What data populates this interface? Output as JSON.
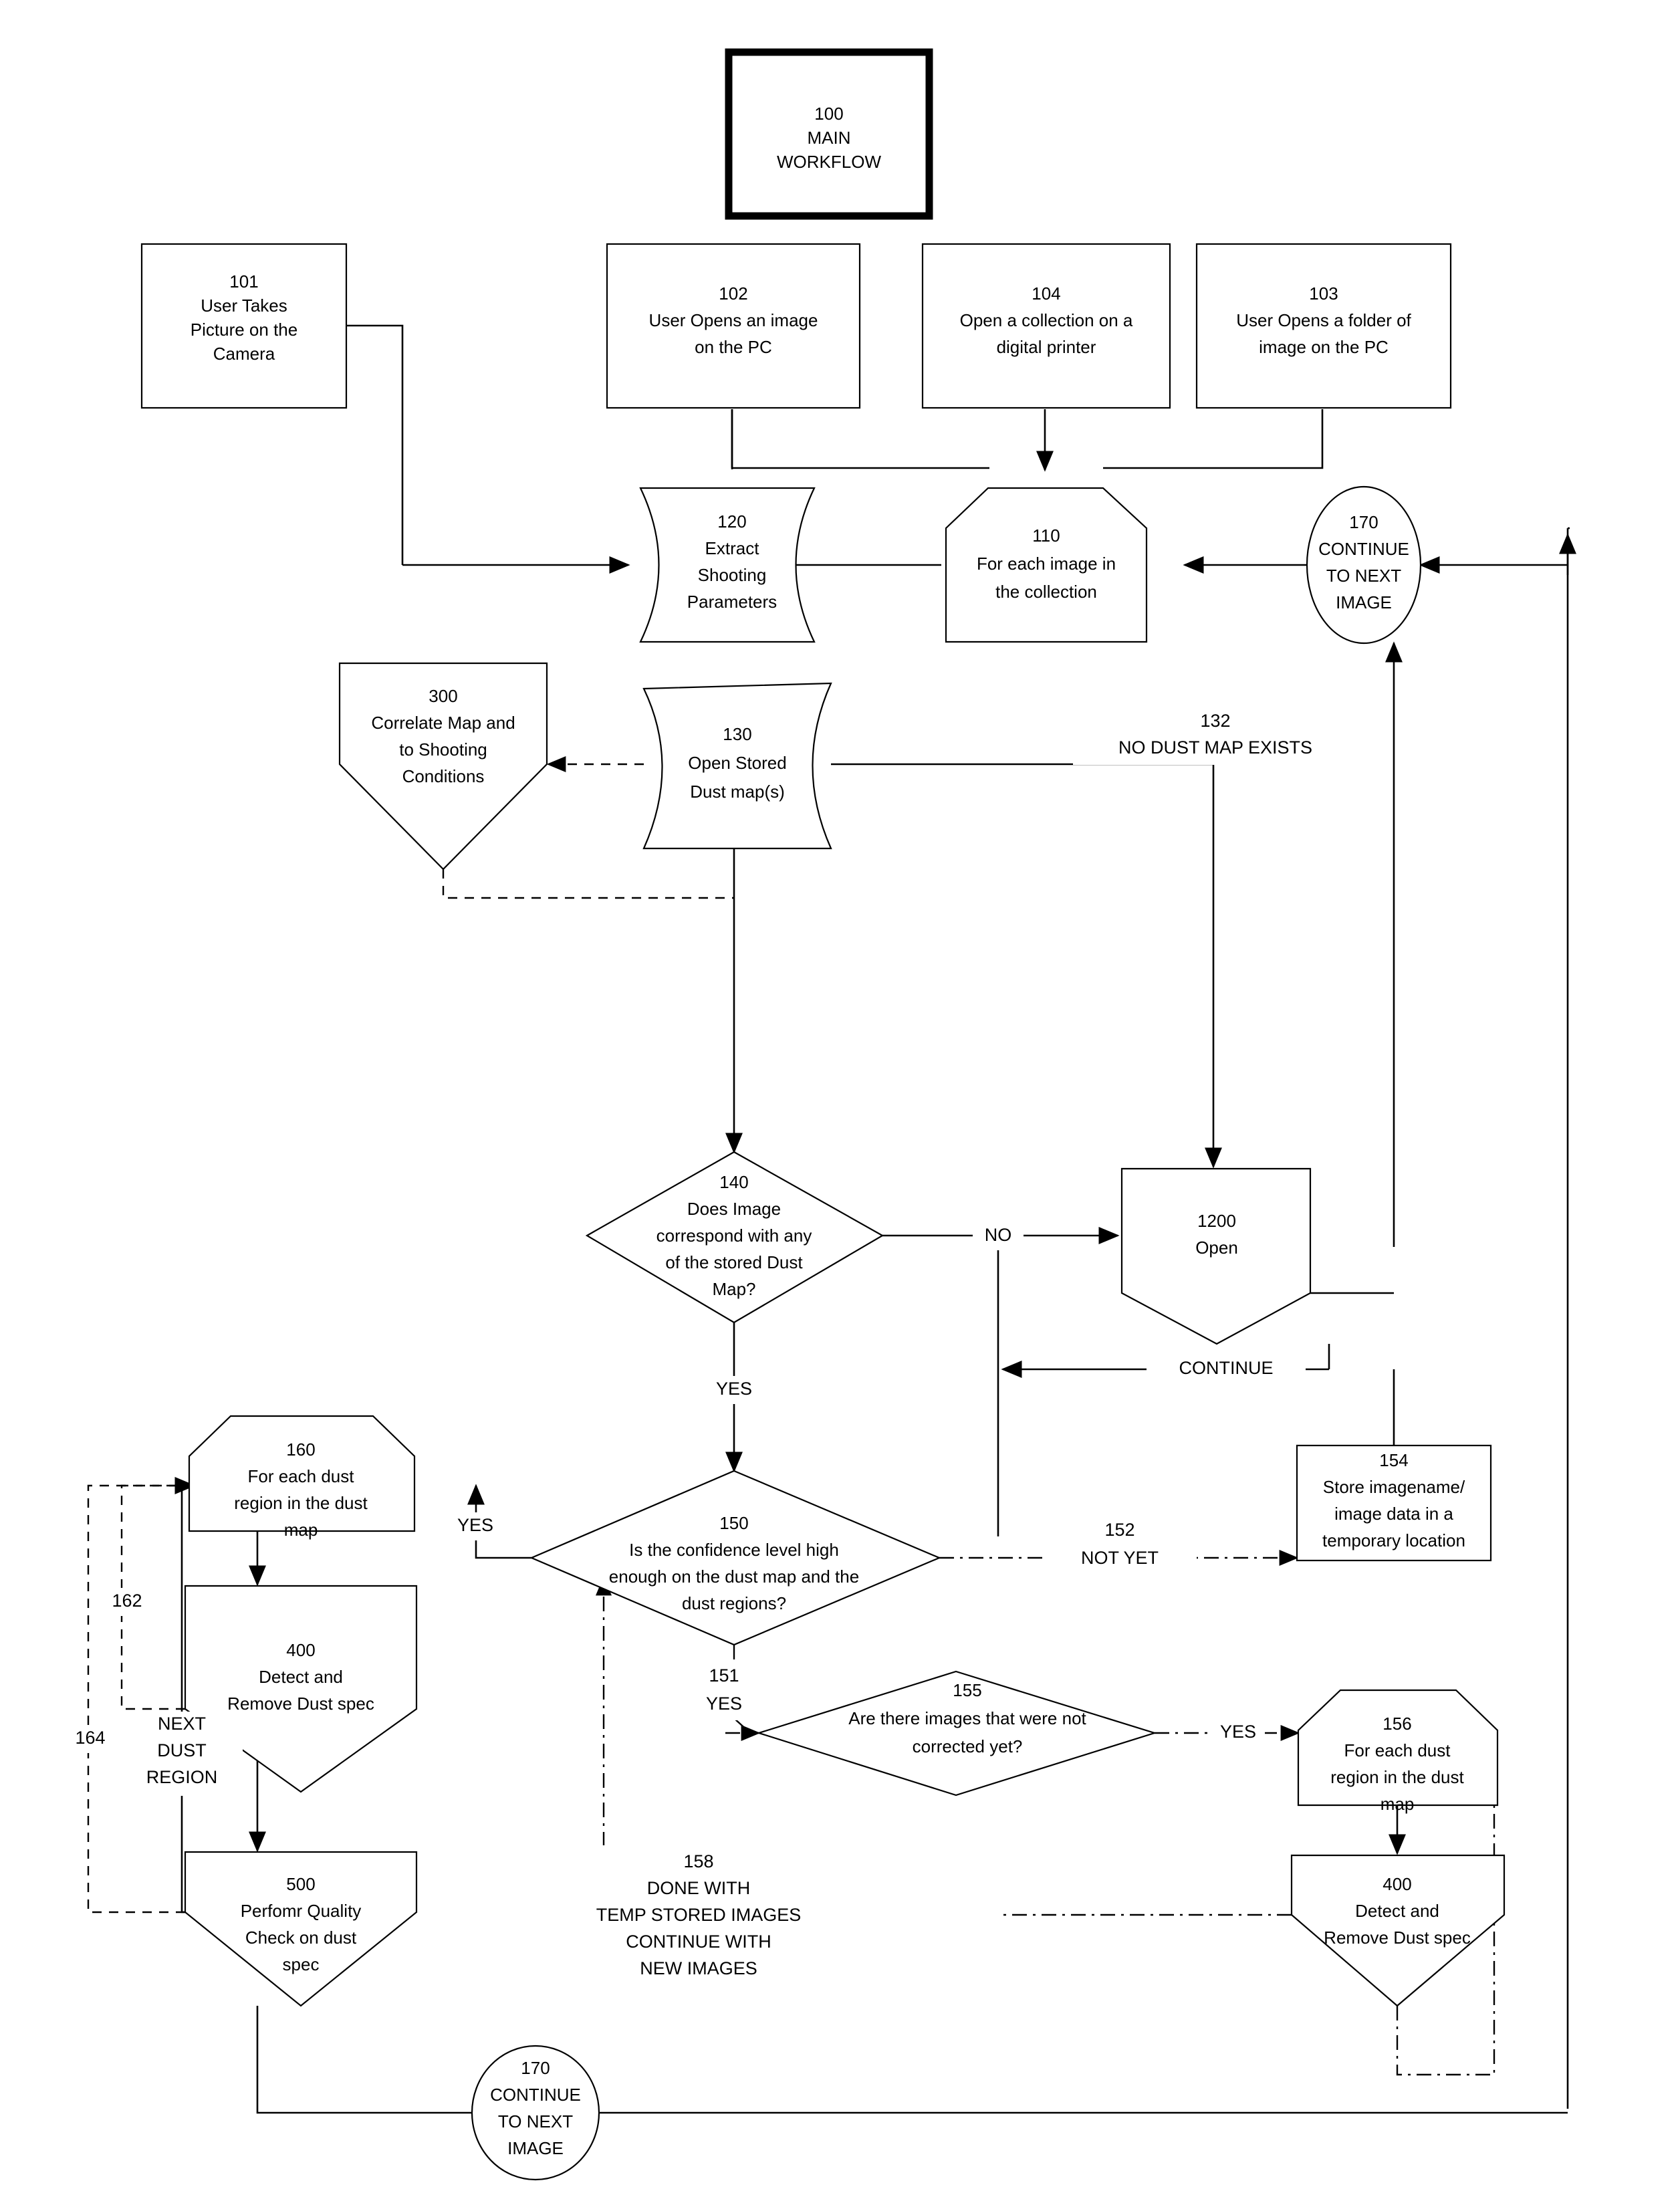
{
  "diagram": {
    "title": "Main Workflow Flowchart",
    "nodes": {
      "n100": {
        "id": "100",
        "lines": [
          "100",
          "MAIN",
          "WORKFLOW"
        ]
      },
      "n101": {
        "id": "101",
        "lines": [
          "101",
          "User Takes",
          "Picture on the",
          "Camera"
        ]
      },
      "n102": {
        "id": "102",
        "lines": [
          "102",
          "User Opens an image",
          "on the PC"
        ]
      },
      "n104": {
        "id": "104",
        "lines": [
          "104",
          "Open a collection on a",
          "digital printer"
        ]
      },
      "n103": {
        "id": "103",
        "lines": [
          "103",
          "User Opens a folder of",
          "image on the PC"
        ]
      },
      "n120": {
        "id": "120",
        "lines": [
          "120",
          "Extract",
          "Shooting",
          "Parameters"
        ]
      },
      "n110": {
        "id": "110",
        "lines": [
          "110",
          "For each image in",
          "the collection"
        ]
      },
      "n170top": {
        "id": "170",
        "lines": [
          "170",
          "CONTINUE",
          "TO NEXT",
          "IMAGE"
        ]
      },
      "n300": {
        "id": "300",
        "lines": [
          "300",
          "Correlate Map and",
          "to Shooting",
          "Conditions"
        ]
      },
      "n130": {
        "id": "130",
        "lines": [
          "130",
          "Open Stored",
          "Dust map(s)"
        ]
      },
      "n140": {
        "id": "140",
        "lines": [
          "140",
          "Does Image",
          "correspond with any",
          "of the stored Dust",
          "Map?"
        ]
      },
      "n1200": {
        "id": "1200",
        "lines": [
          "1200",
          "Open"
        ]
      },
      "n150": {
        "id": "150",
        "lines": [
          "150",
          "Is the confidence level high",
          "enough on the dust map and the",
          "dust regions?"
        ]
      },
      "n154": {
        "id": "154",
        "lines": [
          "154",
          "Store imagename/",
          "image data in a",
          "temporary location"
        ]
      },
      "n160": {
        "id": "160",
        "lines": [
          "160",
          "For each dust",
          "region in the dust",
          "map"
        ]
      },
      "n400a": {
        "id": "400",
        "lines": [
          "400",
          "Detect and",
          "Remove Dust spec"
        ]
      },
      "n500": {
        "id": "500",
        "lines": [
          "500",
          "Perfomr Quality",
          "Check on dust",
          "spec"
        ]
      },
      "n155": {
        "id": "155",
        "lines": [
          "155",
          "Are there images that were not",
          "corrected yet?"
        ]
      },
      "n156": {
        "id": "156",
        "lines": [
          "156",
          "For each dust",
          "region in the dust",
          "map"
        ]
      },
      "n400b": {
        "id": "400",
        "lines": [
          "400",
          "Detect and",
          "Remove Dust spec"
        ]
      },
      "n170bottom": {
        "id": "170",
        "lines": [
          "170",
          "CONTINUE",
          "TO NEXT",
          "IMAGE"
        ]
      }
    },
    "edge_labels": {
      "e132": {
        "lines": [
          "132",
          "NO DUST MAP EXISTS"
        ]
      },
      "e140_no": {
        "lines": [
          "NO"
        ]
      },
      "e140_yes": {
        "lines": [
          "YES"
        ]
      },
      "e1200_continue": {
        "lines": [
          "CONTINUE"
        ]
      },
      "e152": {
        "lines": [
          "152",
          "NOT YET"
        ]
      },
      "e150_yes_left": {
        "lines": [
          "YES"
        ]
      },
      "e151_yes": {
        "lines": [
          "151",
          "YES"
        ]
      },
      "e155_yes": {
        "lines": [
          "YES"
        ]
      },
      "e162": {
        "lines": [
          "162"
        ]
      },
      "e164": {
        "lines": [
          "164"
        ]
      },
      "e_next_dust_region": {
        "lines": [
          "NEXT",
          "DUST",
          "REGION"
        ]
      },
      "e158": {
        "lines": [
          "158",
          "DONE WITH",
          "TEMP STORED IMAGES",
          "CONTINUE WITH",
          "NEW IMAGES"
        ]
      }
    },
    "colors": {
      "stroke": "#000000",
      "fill": "#ffffff",
      "text": "#000000"
    }
  }
}
